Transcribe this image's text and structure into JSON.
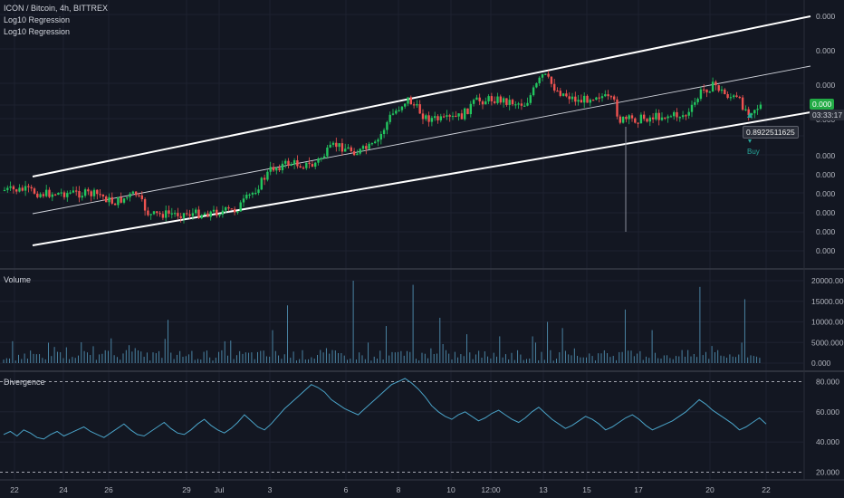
{
  "header": {
    "symbol_line": "ICON / Bitcoin, 4h, BITTREX",
    "indicators": [
      "Log10 Regression",
      "Log10 Regression"
    ]
  },
  "price_pane": {
    "y_tick_labels": [
      "0.000",
      "0.000",
      "0.000",
      "0.000",
      "0.000",
      "0.000",
      "0.000",
      "0.000",
      "0.000",
      "0.000",
      "0.000",
      "0.000",
      "0.000"
    ],
    "last_price_label": "0.000",
    "countdown_label": "03:33:17",
    "annotation_value": "0.8922511625",
    "buy_label": "Buy"
  },
  "volume_pane": {
    "title": "Volume",
    "y_tick_labels": [
      "20000.000",
      "15000.000",
      "10000.000",
      "5000.000",
      "0.000"
    ]
  },
  "divergence_pane": {
    "title": "Divergence",
    "y_tick_labels": [
      "80.000",
      "60.000",
      "40.000",
      "20.000"
    ]
  },
  "x_axis": {
    "tick_labels": [
      "22",
      "24",
      "26",
      "29",
      "Jul",
      "3",
      "6",
      "8",
      "10",
      "12:00",
      "13",
      "15",
      "17",
      "20",
      "22"
    ]
  },
  "colors": {
    "background": "#131722",
    "up": "#26a69a",
    "up_bright": "#22c55e",
    "down": "#ef5350",
    "channel": "#ffffff",
    "volume": "#4f8fb0",
    "divergence": "#4aa3c8",
    "last_price_bg": "#22ab45"
  },
  "chart_data": [
    {
      "type": "candlestick",
      "title": "ICON / Bitcoin, 4h, BITTREX",
      "x": [
        "22",
        "24",
        "26",
        "29",
        "Jul",
        "3",
        "6",
        "8",
        "10",
        "12:00",
        "13",
        "15",
        "17",
        "20",
        "22"
      ],
      "channel_lines": [
        "upper",
        "middle",
        "lower"
      ],
      "annotations": [
        "0.8922511625",
        "Buy"
      ]
    },
    {
      "type": "bar",
      "title": "Volume",
      "ylim": [
        0,
        20000
      ],
      "note": "many thin bars; tallest near 20000"
    },
    {
      "type": "line",
      "title": "Divergence",
      "ylim": [
        15,
        85
      ],
      "reference_lines": [
        80,
        20
      ],
      "values": [
        45,
        47,
        44,
        48,
        46,
        43,
        42,
        45,
        47,
        44,
        46,
        48,
        50,
        47,
        45,
        43,
        46,
        49,
        52,
        48,
        45,
        44,
        47,
        50,
        53,
        49,
        46,
        45,
        48,
        52,
        55,
        51,
        48,
        46,
        49,
        53,
        58,
        54,
        50,
        48,
        52,
        57,
        62,
        66,
        70,
        74,
        78,
        76,
        73,
        68,
        65,
        62,
        60,
        58,
        62,
        66,
        70,
        74,
        78,
        80,
        82,
        79,
        75,
        70,
        64,
        60,
        57,
        55,
        58,
        60,
        57,
        54,
        56,
        59,
        61,
        58,
        55,
        53,
        56,
        60,
        63,
        59,
        55,
        52,
        49,
        51,
        54,
        57,
        55,
        52,
        48,
        50,
        53,
        56,
        58,
        55,
        51,
        48,
        50,
        52,
        54,
        57,
        60,
        64,
        68,
        65,
        61,
        58,
        55,
        52,
        48,
        50,
        53,
        56,
        52
      ]
    }
  ]
}
